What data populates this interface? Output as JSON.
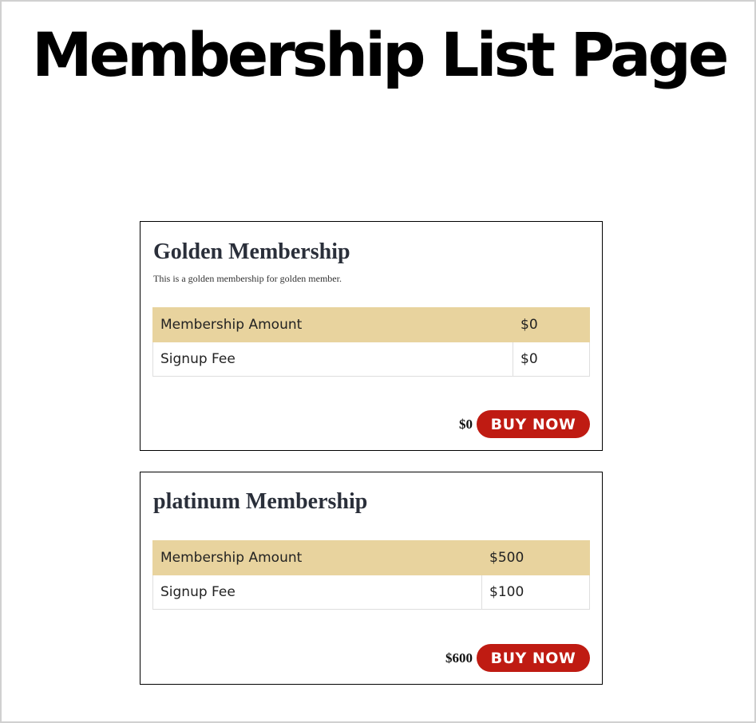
{
  "page": {
    "title": "Membership List Page"
  },
  "memberships": [
    {
      "name": "Golden Membership",
      "description": "This is a golden membership for golden member.",
      "rows": [
        {
          "label": "Membership Amount",
          "value": "$0"
        },
        {
          "label": "Signup Fee",
          "value": "$0"
        }
      ],
      "total": "$0",
      "button_label": "BUY NOW"
    },
    {
      "name": "platinum Membership",
      "rows": [
        {
          "label": "Membership Amount",
          "value": "$500"
        },
        {
          "label": "Signup Fee",
          "value": "$100"
        }
      ],
      "total": "$600",
      "button_label": "BUY NOW"
    }
  ],
  "colors": {
    "accent_button": "#bf1b12",
    "amount_row_background": "#e8d39e",
    "card_title": "#2a2f3a"
  }
}
